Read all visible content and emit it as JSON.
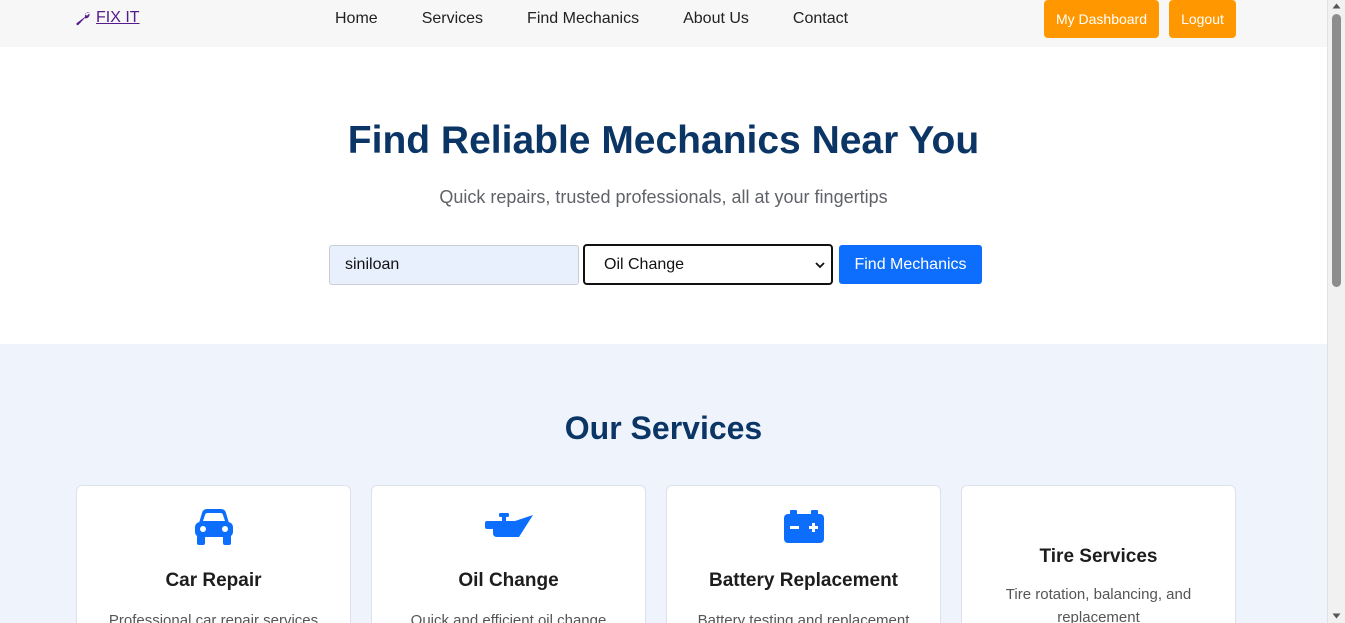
{
  "nav": {
    "logo_text": " FIX IT",
    "logo_icon": "wrench-icon",
    "links": [
      "Home",
      "Services",
      "Find Mechanics",
      "About Us",
      "Contact"
    ],
    "dashboard_label": "My Dashboard",
    "logout_label": "Logout"
  },
  "hero": {
    "title": "Find Reliable Mechanics Near You",
    "subtitle": "Quick repairs, trusted professionals, all at your fingertips",
    "location_value": "siniloan",
    "service_selected": "Oil Change",
    "find_label": "Find Mechanics"
  },
  "services": {
    "title": "Our Services",
    "cards": [
      {
        "title": "Car Repair",
        "desc": "Professional car repair services",
        "icon": "car-icon"
      },
      {
        "title": "Oil Change",
        "desc": "Quick and efficient oil change",
        "icon": "oil-can-icon"
      },
      {
        "title": "Battery Replacement",
        "desc": "Battery testing and replacement",
        "icon": "battery-icon"
      },
      {
        "title": "Tire Services",
        "desc": "Tire rotation, balancing, and replacement",
        "icon": ""
      }
    ]
  },
  "colors": {
    "brand_dark": "#0b3565",
    "accent_orange": "#ff9800",
    "primary_blue": "#0d6efd",
    "services_bg": "#eef3fc"
  }
}
